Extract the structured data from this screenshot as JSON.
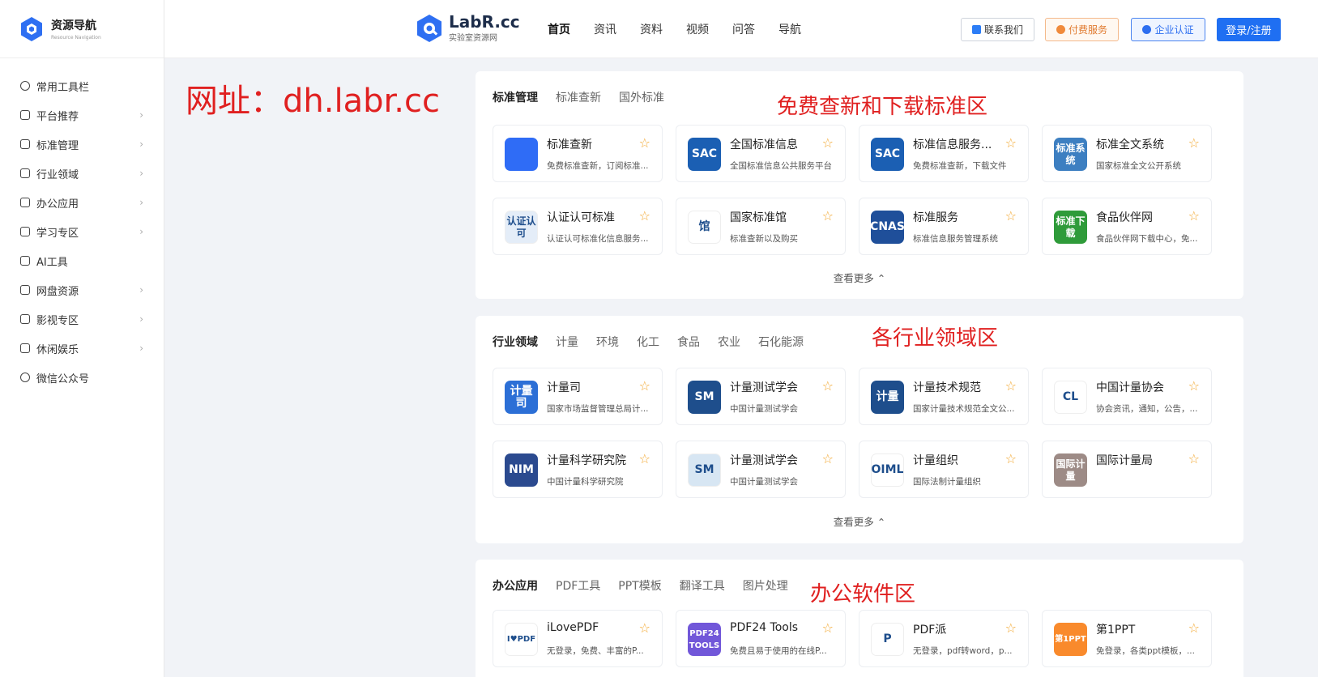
{
  "sidebar": {
    "logo_title": "资源导航",
    "logo_sub": "Resource Navigation",
    "items": [
      {
        "label": "常用工具栏",
        "icon": "clock-icon",
        "chevron": false
      },
      {
        "label": "平台推荐",
        "icon": "thumbs-up-icon",
        "chevron": true
      },
      {
        "label": "标准管理",
        "icon": "bag-icon",
        "chevron": true
      },
      {
        "label": "行业领域",
        "icon": "robot-icon",
        "chevron": true
      },
      {
        "label": "办公应用",
        "icon": "briefcase-icon",
        "chevron": true
      },
      {
        "label": "学习专区",
        "icon": "graduation-cap-icon",
        "chevron": true
      },
      {
        "label": "AI工具",
        "icon": "ai-icon",
        "chevron": false
      },
      {
        "label": "网盘资源",
        "icon": "document-icon",
        "chevron": true
      },
      {
        "label": "影视专区",
        "icon": "tv-icon",
        "chevron": true
      },
      {
        "label": "休闲娱乐",
        "icon": "cup-icon",
        "chevron": true
      },
      {
        "label": "微信公众号",
        "icon": "wechat-icon",
        "chevron": false
      }
    ]
  },
  "header": {
    "brand_title": "LabR.cc",
    "brand_sub": "实验室资源网",
    "nav": [
      "首页",
      "资讯",
      "资料",
      "视频",
      "问答",
      "导航"
    ],
    "btn_contact": "联系我们",
    "btn_paid": "付费服务",
    "btn_enterprise": "企业认证",
    "btn_login": "登录/注册"
  },
  "overlay": {
    "url": "网址：dh.labr.cc"
  },
  "sections": [
    {
      "tabs": [
        "标准管理",
        "标准查新",
        "国外标准"
      ],
      "annotation": "免费查新和下载标准区",
      "more": "查看更多",
      "cards": [
        {
          "title": "标准查新",
          "desc": "免费标准查新，订阅标准...",
          "icon_text": "",
          "icon_bg": "#2f6cf6",
          "icon": "magnifier-icon"
        },
        {
          "title": "全国标准信息",
          "desc": "全国标准信息公共服务平台",
          "icon_text": "SAC",
          "icon_bg": "#1b5fb3",
          "icon": "sac-logo-icon"
        },
        {
          "title": "标准信息服务...",
          "desc": "免费标准查新，下载文件",
          "icon_text": "SAC",
          "icon_bg": "#1b5fb3",
          "icon": "sac-logo-icon"
        },
        {
          "title": "标准全文系统",
          "desc": "国家标准全文公开系统",
          "icon_text": "标准系统",
          "icon_bg": "#3d7fc1",
          "icon": "standard-system-icon"
        },
        {
          "title": "认证认可标准",
          "desc": "认证认可标准化信息服务...",
          "icon_text": "认证认可",
          "icon_bg": "#e4edf8",
          "icon": "certification-icon"
        },
        {
          "title": "国家标准馆",
          "desc": "标准查新以及购买",
          "icon_text": "馆",
          "icon_bg": "#ffffff",
          "icon": "library-logo-icon"
        },
        {
          "title": "标准服务",
          "desc": "标准信息服务管理系统",
          "icon_text": "CNAS",
          "icon_bg": "#1f4f9a",
          "icon": "cnas-logo-icon"
        },
        {
          "title": "食品伙伴网",
          "desc": "食品伙伴网下载中心，免...",
          "icon_text": "标准下载",
          "icon_bg": "#2f9b3a",
          "icon": "download-standard-icon"
        }
      ]
    },
    {
      "tabs": [
        "行业领域",
        "计量",
        "环境",
        "化工",
        "食品",
        "农业",
        "石化能源"
      ],
      "annotation": "各行业领域区",
      "more": "查看更多",
      "cards": [
        {
          "title": "计量司",
          "desc": "国家市场监督管理总局计...",
          "icon_text": "计量司",
          "icon_bg": "#2c6fd6",
          "icon": "metrology-dept-icon"
        },
        {
          "title": "计量测试学会",
          "desc": "中国计量测试学会",
          "icon_text": "SM",
          "icon_bg": "#1e4e8c",
          "icon": "sm-logo-icon"
        },
        {
          "title": "计量技术规范",
          "desc": "国家计量技术规范全文公...",
          "icon_text": "计量",
          "icon_bg": "#1e4e8c",
          "icon": "metrology-spec-icon"
        },
        {
          "title": "中国计量协会",
          "desc": "协会资讯，通知，公告，...",
          "icon_text": "CL",
          "icon_bg": "#ffffff",
          "icon": "cma-logo-icon"
        },
        {
          "title": "计量科学研究院",
          "desc": "中国计量科学研究院",
          "icon_text": "NIM",
          "icon_bg": "#2b4a8f",
          "icon": "nim-logo-icon"
        },
        {
          "title": "计量测试学会",
          "desc": "中国计量测试学会",
          "icon_text": "SM",
          "icon_bg": "#d7e6f3",
          "icon": "sm-logo-icon"
        },
        {
          "title": "计量组织",
          "desc": "国际法制计量组织",
          "icon_text": "OIML",
          "icon_bg": "#ffffff",
          "icon": "oiml-logo-icon"
        },
        {
          "title": "国际计量局",
          "desc": "",
          "icon_text": "国际计量",
          "icon_bg": "#9d8b86",
          "icon": "bipm-icon"
        }
      ]
    },
    {
      "tabs": [
        "办公应用",
        "PDF工具",
        "PPT模板",
        "翻译工具",
        "图片处理"
      ],
      "annotation": "办公软件区",
      "more": "",
      "cards": [
        {
          "title": "iLovePDF",
          "desc": "无登录，免费、丰富的P...",
          "icon_text": "I♥PDF",
          "icon_bg": "#ffffff",
          "icon": "ilovepdf-logo-icon"
        },
        {
          "title": "PDF24 Tools",
          "desc": "免费且易于使用的在线P...",
          "icon_text": "PDF24 TOOLS",
          "icon_bg": "#7157d9",
          "icon": "pdf24-logo-icon"
        },
        {
          "title": "PDF派",
          "desc": "无登录，pdf转word，p...",
          "icon_text": "P",
          "icon_bg": "#ffffff",
          "icon": "pdfpai-logo-icon"
        },
        {
          "title": "第1PPT",
          "desc": "免登录，各类ppt模板，...",
          "icon_text": "第1PPT",
          "icon_bg": "#f98a2c",
          "icon": "1ppt-logo-icon"
        }
      ]
    }
  ]
}
